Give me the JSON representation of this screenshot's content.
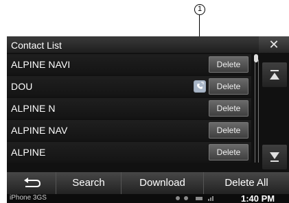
{
  "annotation": {
    "callout_number": "1"
  },
  "header": {
    "title": "Contact List",
    "close_symbol": "✕"
  },
  "contacts": [
    {
      "name": "ALPINE NAVI",
      "delete_label": "Delete"
    },
    {
      "name": "DOU",
      "delete_label": "Delete",
      "icon": "phone-device-icon"
    },
    {
      "name": "ALPINE N",
      "delete_label": "Delete"
    },
    {
      "name": "ALPINE NAV",
      "delete_label": "Delete"
    },
    {
      "name": "ALPINE",
      "delete_label": "Delete"
    }
  ],
  "scroll": {
    "up_icon": "scroll-top-icon",
    "down_icon": "scroll-bottom-icon"
  },
  "footer": {
    "back_icon": "back-arrow-icon",
    "search_label": "Search",
    "download_label": "Download",
    "delete_all_label": "Delete All"
  },
  "statusbar": {
    "device_name": "iPhone 3GS",
    "time": "1:40 PM"
  },
  "colors": {
    "background": "#111111",
    "button": "#555555",
    "text": "#ffffff"
  }
}
